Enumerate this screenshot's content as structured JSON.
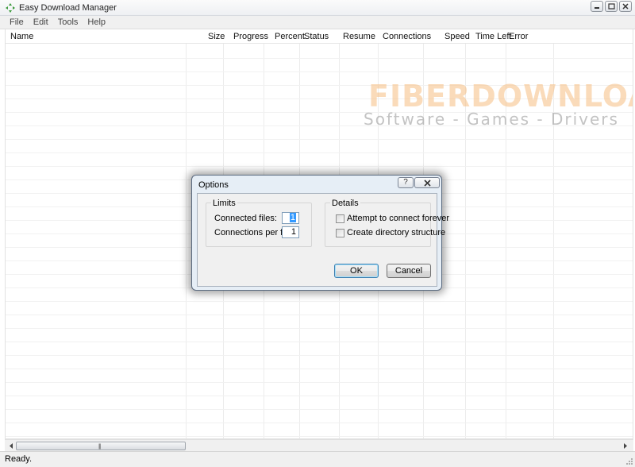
{
  "window": {
    "title": "Easy Download Manager",
    "icon": "download-manager-icon"
  },
  "menu": {
    "items": [
      {
        "label": "File"
      },
      {
        "label": "Edit"
      },
      {
        "label": "Tools"
      },
      {
        "label": "Help"
      }
    ]
  },
  "columns": [
    {
      "label": "Name"
    },
    {
      "label": "Size"
    },
    {
      "label": "Progress"
    },
    {
      "label": "Percent"
    },
    {
      "label": "Status"
    },
    {
      "label": "Resume"
    },
    {
      "label": "Connections"
    },
    {
      "label": "Speed"
    },
    {
      "label": "Time Left"
    },
    {
      "label": "Error"
    }
  ],
  "watermark": {
    "brand": "FIBERDOWNLOAD",
    "tagline": "Software - Games - Drivers"
  },
  "status": {
    "text": "Ready."
  },
  "dialog": {
    "title": "Options",
    "help_label": "?",
    "limits": {
      "label": "Limits",
      "connected_files_label": "Connected files:",
      "connected_files_value": "1",
      "connections_per_file_label": "Connections per file:",
      "connections_per_file_value": "1"
    },
    "details": {
      "label": "Details",
      "connect_forever_label": "Attempt to connect forever",
      "connect_forever_checked": false,
      "create_dirs_label": "Create directory structure",
      "create_dirs_checked": false
    },
    "ok_label": "OK",
    "cancel_label": "Cancel"
  }
}
